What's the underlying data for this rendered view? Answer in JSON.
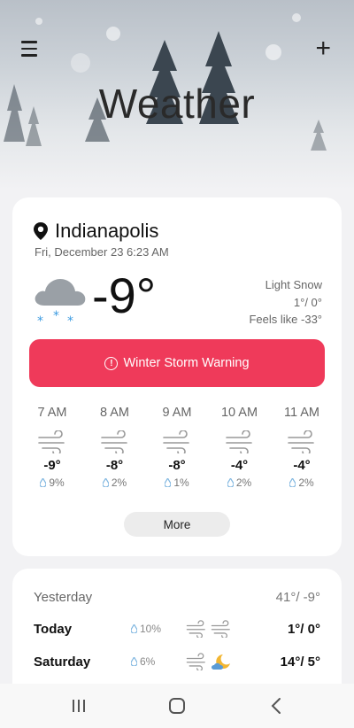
{
  "app": {
    "title": "Weather"
  },
  "current": {
    "location": "Indianapolis",
    "datetime": "Fri, December 23 6:23 AM",
    "temperature": "-9°",
    "condition": "Light Snow",
    "high_low": "1°/ 0°",
    "feels_like": "Feels like -33°"
  },
  "alert": {
    "label": "Winter Storm Warning",
    "color": "#ef3a5a"
  },
  "hourly": [
    {
      "time": "7 AM",
      "temp": "-9°",
      "precip": "9%"
    },
    {
      "time": "8 AM",
      "temp": "-8°",
      "precip": "2%"
    },
    {
      "time": "9 AM",
      "temp": "-8°",
      "precip": "1%"
    },
    {
      "time": "10 AM",
      "temp": "-4°",
      "precip": "2%"
    },
    {
      "time": "11 AM",
      "temp": "-4°",
      "precip": "2%"
    }
  ],
  "more_label": "More",
  "daily": {
    "yesterday": {
      "label": "Yesterday",
      "high_low": "41°/ -9°"
    },
    "days": [
      {
        "label": "Today",
        "precip": "10%",
        "icons": [
          "wind-icon",
          "wind-icon"
        ],
        "high_low": "1°/ 0°"
      },
      {
        "label": "Saturday",
        "precip": "6%",
        "icons": [
          "wind-icon",
          "moon-cloud-icon"
        ],
        "high_low": "14°/ 5°"
      }
    ]
  },
  "colors": {
    "accent": "#ef3a5a",
    "raindrop": "#7fb6e0",
    "snowflake": "#3b9be0"
  }
}
